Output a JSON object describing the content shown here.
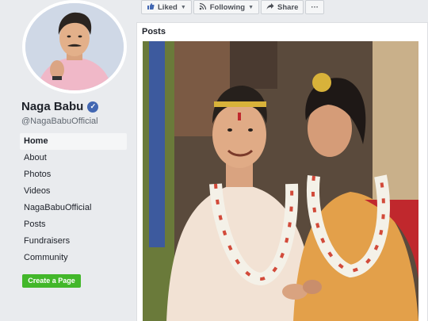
{
  "profile": {
    "name": "Naga Babu",
    "handle": "@NagaBabuOfficial",
    "verified_mark": "✓"
  },
  "nav": {
    "items": [
      {
        "label": "Home",
        "active": true
      },
      {
        "label": "About"
      },
      {
        "label": "Photos"
      },
      {
        "label": "Videos"
      },
      {
        "label": "NagaBabuOfficial"
      },
      {
        "label": "Posts"
      },
      {
        "label": "Fundraisers"
      },
      {
        "label": "Community"
      }
    ]
  },
  "create_page_label": "Create a Page",
  "actions": {
    "liked": "Liked",
    "following": "Following",
    "share": "Share",
    "more": "···"
  },
  "posts": {
    "title": "Posts"
  },
  "icons": {
    "liked": "thumbs-up-icon",
    "following": "rss-icon",
    "share": "share-arrow-icon",
    "verified": "verified-badge-icon"
  },
  "colors": {
    "brand": "#4267b2",
    "create_button": "#42b72a",
    "background": "#e9ebee"
  }
}
